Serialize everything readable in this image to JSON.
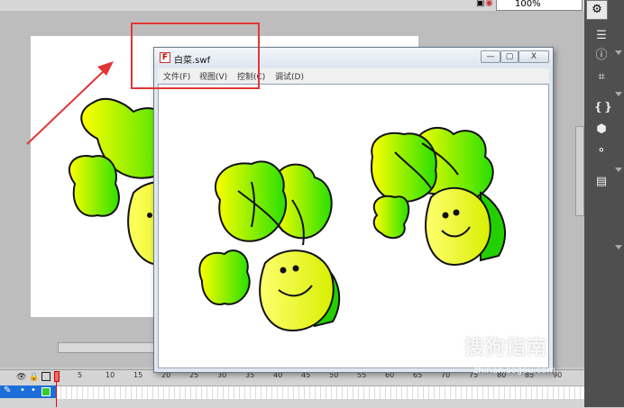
{
  "zoom": {
    "value": "100%"
  },
  "swf_window": {
    "title": "白菜.swf",
    "icon_letter": "F",
    "menus": [
      "文件(F)",
      "视图(V)",
      "控制(C)",
      "调试(D)"
    ],
    "minimize": "—",
    "maximize": "▢",
    "close": "X"
  },
  "timeline": {
    "frame_ticks": [
      "1",
      "5",
      "10",
      "15",
      "20",
      "25",
      "30",
      "35",
      "40",
      "45",
      "50",
      "55",
      "60",
      "65",
      "70",
      "75",
      "80",
      "85",
      "90"
    ]
  },
  "watermark": {
    "text": "搜狗指南",
    "sub": "zhinan.sogou.com"
  },
  "colors": {
    "annotation": "#e23636",
    "layer_selected": "#1c6fd9",
    "playhead": "#e00000"
  }
}
